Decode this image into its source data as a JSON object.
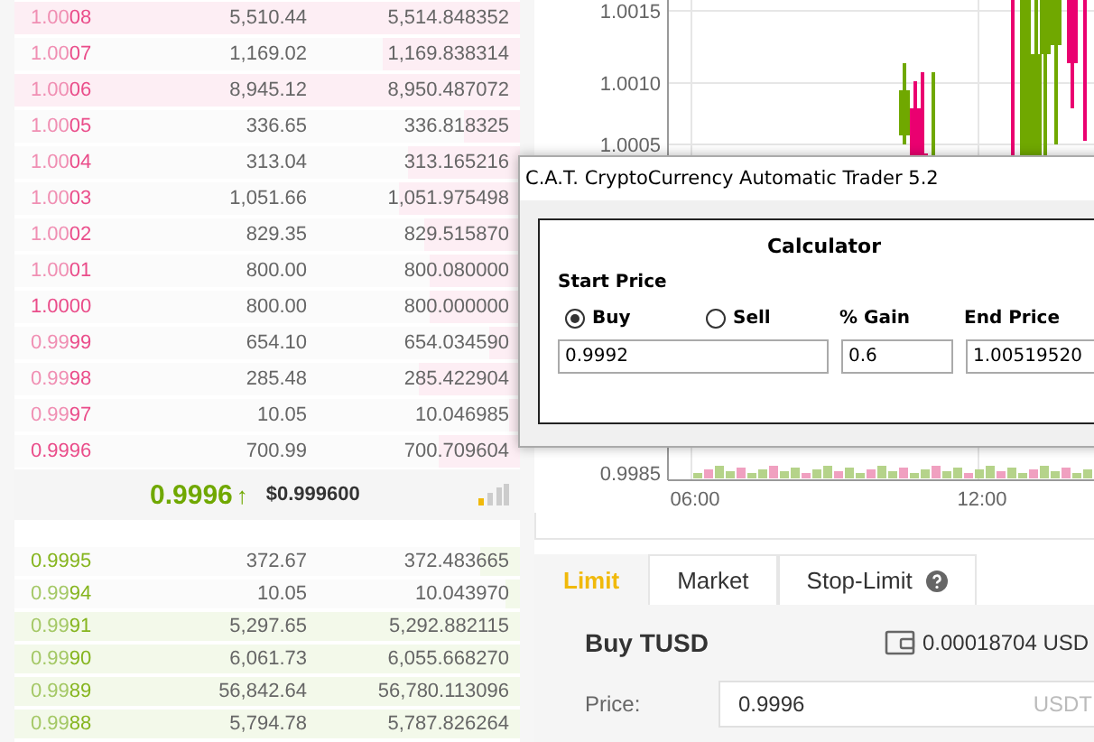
{
  "order_book": {
    "asks": [
      {
        "price_dim": "1.00",
        "price_bright": "08",
        "amount": "5,510.44",
        "total": "5,514.848352",
        "level": 1
      },
      {
        "price_dim": "1.00",
        "price_bright": "07",
        "amount": "1,169.02",
        "total": "1,169.838314",
        "level": 0.27
      },
      {
        "price_dim": "1.00",
        "price_bright": "06",
        "amount": "8,945.12",
        "total": "8,950.487072",
        "level": 1
      },
      {
        "price_dim": "1.00",
        "price_bright": "05",
        "amount": "336.65",
        "total": "336.818325",
        "level": 0.11
      },
      {
        "price_dim": "1.00",
        "price_bright": "04",
        "amount": "313.04",
        "total": "313.165216",
        "level": 0.22
      },
      {
        "price_dim": "1.00",
        "price_bright": "03",
        "amount": "1,051.66",
        "total": "1,051.975498",
        "level": 0.24
      },
      {
        "price_dim": "1.00",
        "price_bright": "02",
        "amount": "829.35",
        "total": "829.515870",
        "level": 0.19
      },
      {
        "price_dim": "1.00",
        "price_bright": "01",
        "amount": "800.00",
        "total": "800.080000",
        "level": 0.18
      },
      {
        "price_bright": "1.0000",
        "amount": "800.00",
        "total": "800.000000",
        "level": 0.18
      },
      {
        "price_dim": "0.99",
        "price_bright": "99",
        "amount": "654.10",
        "total": "654.034590",
        "level": 0.06
      },
      {
        "price_dim": "0.99",
        "price_bright": "98",
        "amount": "285.48",
        "total": "285.422904",
        "level": 0.2
      },
      {
        "price_dim": "0.99",
        "price_bright": "97",
        "amount": "10.05",
        "total": "10.046985",
        "level": 0.02
      },
      {
        "price_bright": "0.9996",
        "amount": "700.99",
        "total": "700.709604",
        "level": 0.16
      }
    ],
    "last_price": {
      "price": "0.9996",
      "arrow": "↑",
      "usd": "$0.999600"
    },
    "bids": [
      {
        "price_bright": "0.9995",
        "amount": "372.67",
        "total": "372.483665",
        "level": 0.08
      },
      {
        "price_dim": "0.99",
        "price_bright": "94",
        "amount": "10.05",
        "total": "10.043970",
        "level": 0.03
      },
      {
        "price_dim": "0.99",
        "price_bright": "91",
        "amount": "5,297.65",
        "total": "5,292.882115",
        "level": 1
      },
      {
        "price_dim": "0.99",
        "price_bright": "90",
        "amount": "6,061.73",
        "total": "6,055.668270",
        "level": 1
      },
      {
        "price_dim": "0.99",
        "price_bright": "89",
        "amount": "56,842.64",
        "total": "56,780.113096",
        "level": 1
      },
      {
        "price_dim": "0.99",
        "price_bright": "88",
        "amount": "5,794.78",
        "total": "5,787.826264",
        "level": 1
      }
    ]
  },
  "chart": {
    "y_labels": [
      "1.0015",
      "1.0010",
      "1.0005",
      "0.9985"
    ],
    "x_labels": [
      "06:00",
      "12:00"
    ]
  },
  "dialog": {
    "title": "C.A.T. CryptoCurrency Automatic Trader 5.2",
    "heading": "Calculator",
    "start_price_label": "Start Price",
    "options": [
      {
        "label": "Buy",
        "selected": true
      },
      {
        "label": "Sell",
        "selected": false
      }
    ],
    "gain_label": "% Gain",
    "end_price_label": "End Price",
    "start_price": "0.9992",
    "gain": "0.6",
    "end_price": "1.00519520"
  },
  "order_form": {
    "tabs": [
      {
        "label": "Limit",
        "selected": true
      },
      {
        "label": "Market",
        "selected": false
      },
      {
        "label": "Stop-Limit",
        "selected": false,
        "help": true
      }
    ],
    "title": "Buy TUSD",
    "balance": "0.00018704 USD",
    "price_label": "Price:",
    "price": "0.9996",
    "price_unit": "USDT"
  }
}
